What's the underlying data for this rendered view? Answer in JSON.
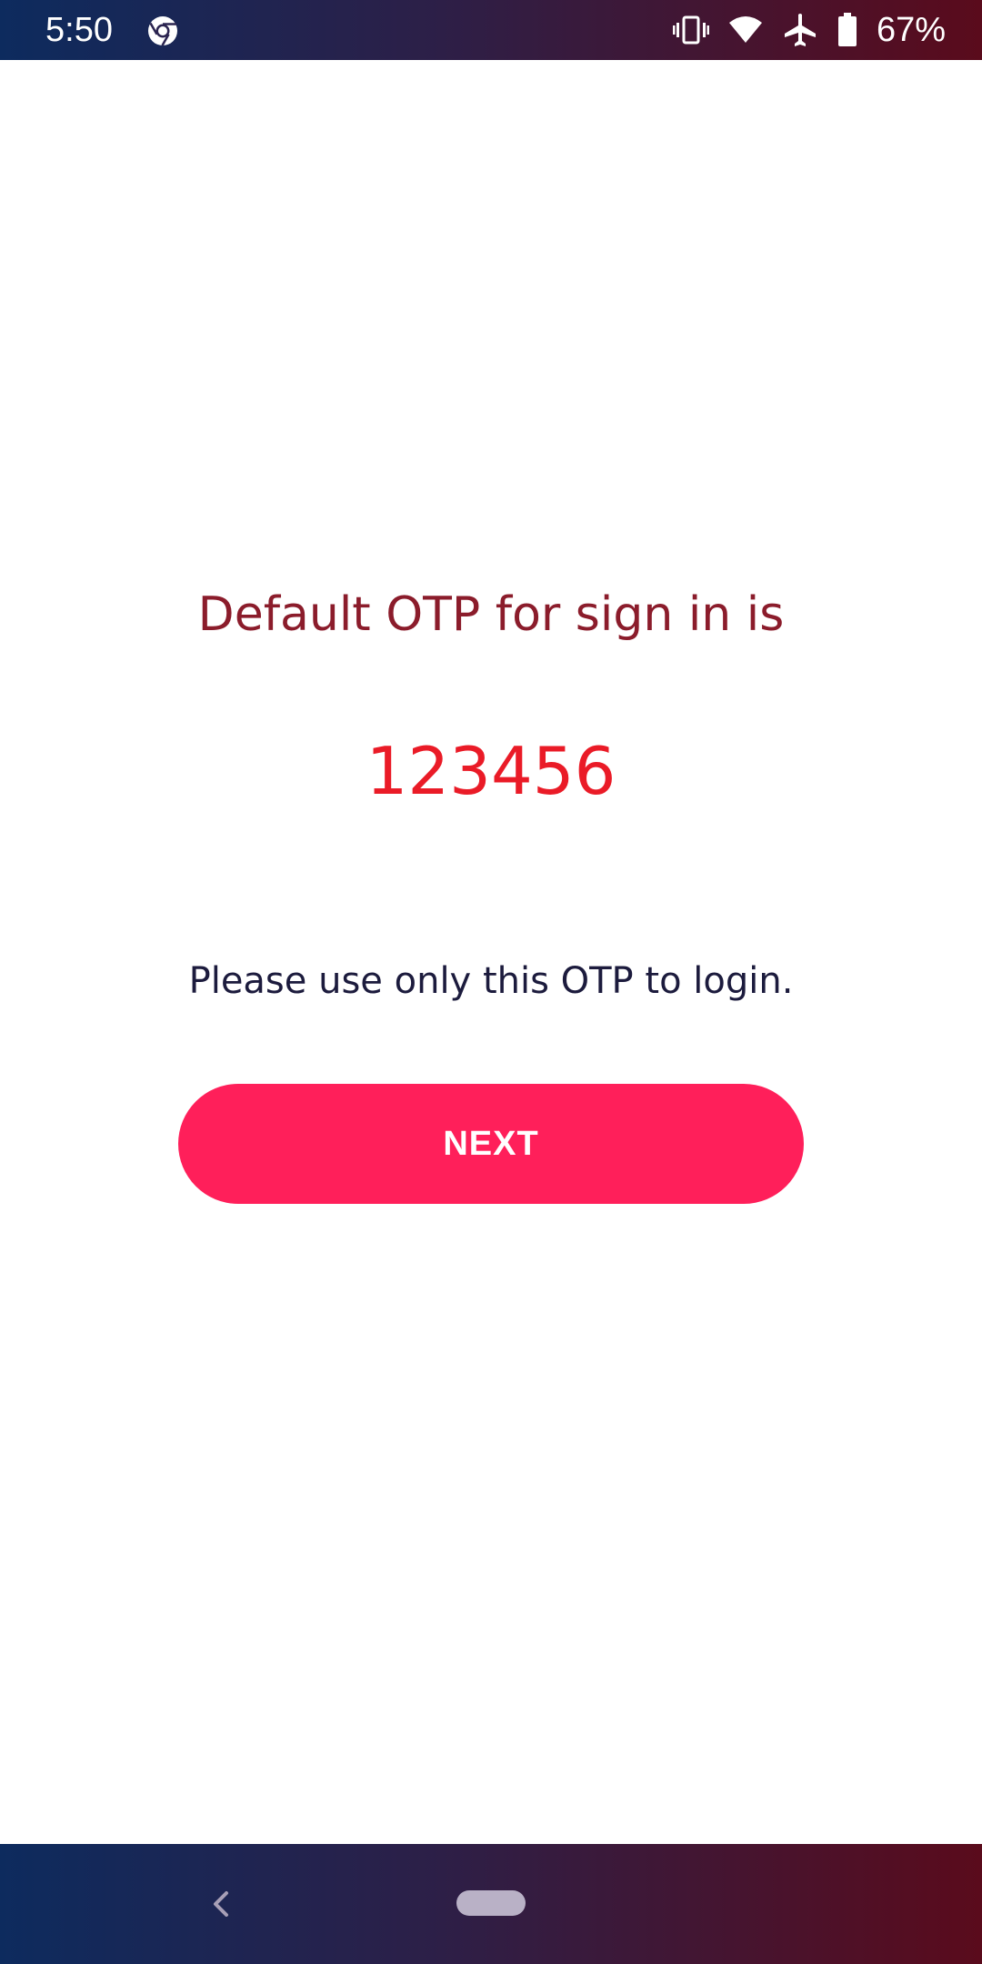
{
  "status_bar": {
    "time": "5:50",
    "battery": "67%",
    "icons": [
      "chrome-icon",
      "vibrate-icon",
      "wifi-icon",
      "airplane-icon",
      "battery-icon"
    ]
  },
  "main": {
    "title": "Default OTP for sign in is",
    "otp_code": "123456",
    "note": "Please use only this OTP to login.",
    "next_label": "NEXT"
  },
  "nav_bar": {
    "icons": [
      "back-icon",
      "home-pill-icon"
    ]
  },
  "colors": {
    "title": "#8b1c2b",
    "otp": "#ea1b27",
    "note": "#1c1b3d",
    "button": "#ff1f5a",
    "bar_gradient_start": "#0d2b5e",
    "bar_gradient_end": "#5a0b1c"
  }
}
